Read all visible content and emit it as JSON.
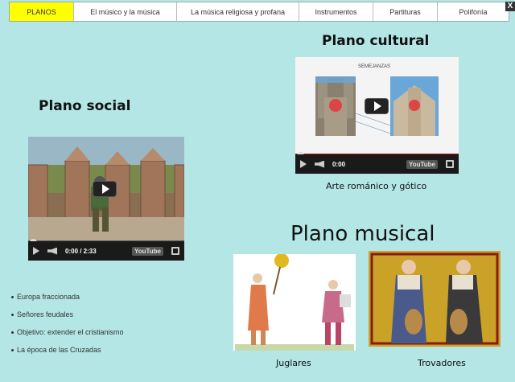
{
  "nav": {
    "items": [
      {
        "label": "PLANOS",
        "active": true
      },
      {
        "label": "El músico y la música",
        "active": false
      },
      {
        "label": "La música religiosa y profana",
        "active": false
      },
      {
        "label": "Instrumentos",
        "active": false
      },
      {
        "label": "Partituras",
        "active": false
      },
      {
        "label": "Polifonía",
        "active": false
      }
    ],
    "close_label": "X"
  },
  "sections": {
    "cultural": {
      "title": "Plano cultural",
      "slide_heading": "SEMEJANZAS",
      "time": "0:00",
      "caption": "Arte románico y gótico"
    },
    "social": {
      "title": "Plano social",
      "time": "0:00 / 2:33"
    },
    "musical": {
      "title": "Plano musical",
      "juglares_caption": "Juglares",
      "trovadores_caption": "Trovadores"
    }
  },
  "bullets": [
    "Europa fraccionada",
    "Señores feudales",
    "Objetivo: extender el cristianismo",
    "La época de las Cruzadas"
  ],
  "colors": {
    "background": "#b4e6e6",
    "nav_active": "#ffff00",
    "progress": "#cc0000"
  }
}
